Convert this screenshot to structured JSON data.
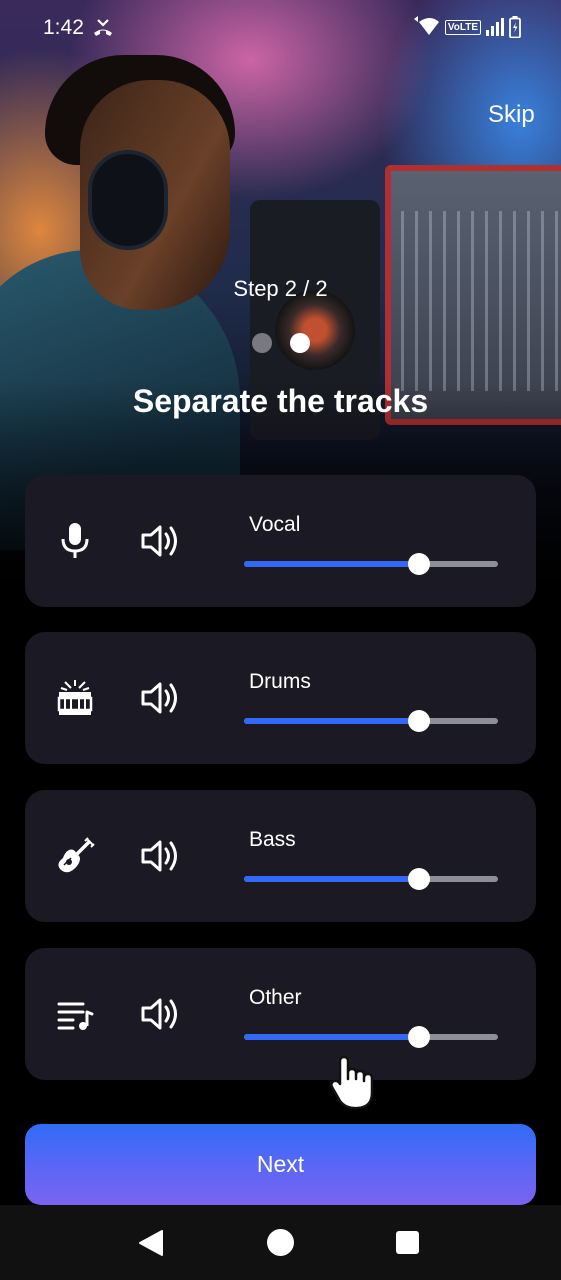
{
  "status_bar": {
    "time": "1:42",
    "network_badge": "VoLTE",
    "icons": [
      "call-missed-icon",
      "wifi-icon",
      "volte-icon",
      "signal-icon",
      "battery-icon"
    ]
  },
  "header": {
    "skip_label": "Skip",
    "step_text": "Step 2 / 2",
    "page_count": 2,
    "active_page": 2,
    "title": "Separate the tracks"
  },
  "tracks": [
    {
      "label": "Vocal",
      "icon": "microphone-icon",
      "volume_icon": "volume-icon",
      "level_percent": 69
    },
    {
      "label": "Drums",
      "icon": "drum-icon",
      "volume_icon": "volume-icon",
      "level_percent": 69
    },
    {
      "label": "Bass",
      "icon": "guitar-icon",
      "volume_icon": "volume-icon",
      "level_percent": 69
    },
    {
      "label": "Other",
      "icon": "playlist-music-icon",
      "volume_icon": "volume-icon",
      "level_percent": 69
    }
  ],
  "next_label": "Next",
  "colors": {
    "accent_blue": "#3169f5",
    "button_gradient_start": "#2f6cf7",
    "button_gradient_end": "#7a63f2",
    "card_background": "#1b1a24",
    "slider_track": "#8e8e96"
  },
  "navigation": [
    "back-icon",
    "home-icon",
    "recents-icon"
  ]
}
